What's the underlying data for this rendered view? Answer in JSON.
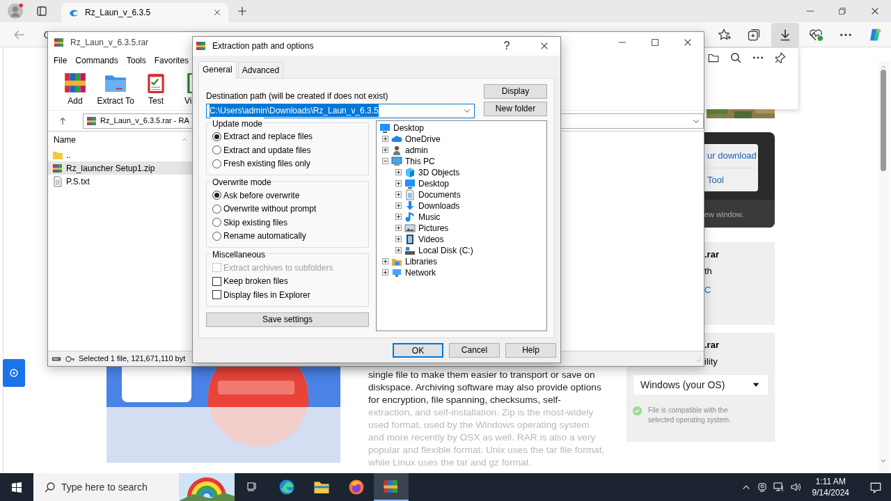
{
  "browser": {
    "tabs": [
      {
        "label": "Rz_Laun_v_6.3.5",
        "selected": true
      }
    ]
  },
  "page": {
    "cards": [
      {
        "kind": "dark",
        "links": [
          "ur download",
          "Tool"
        ],
        "note": "ew window."
      },
      {
        "kind": "light",
        "title": ".rar",
        "text": "th",
        "link": "C"
      },
      {
        "kind": "os",
        "title": ".rar",
        "text": "ility",
        "select": "Windows (your OS)",
        "note": "File is compatible with the selected operating system."
      }
    ],
    "paragraphs": [
      {
        "text": "single file to make them easier to transport or save on diskspace. Archiving software may also provide options for encryption, file spanning, checksums, self-",
        "faded": false
      },
      {
        "text": "extraction, and self-installation. Zip is the most-widely used format, used by the Windows operating system and more recently by OSX as well. RAR is also a very popular and flexible format. Unix uses the tar file format, while Linux uses the tar and gz format.",
        "faded": true
      }
    ]
  },
  "winrar": {
    "title": "Rz_Laun_v_6.3.5.rar",
    "menu": [
      "File",
      "Commands",
      "Tools",
      "Favorites"
    ],
    "toolbar": [
      {
        "label": "Add",
        "kind": "add"
      },
      {
        "label": "Extract To",
        "kind": "extract"
      },
      {
        "label": "Test",
        "kind": "test"
      },
      {
        "label": "Vi",
        "kind": "view"
      }
    ],
    "address": "Rz_Laun_v_6.3.5.rar - RA",
    "columns": [
      "Name"
    ],
    "files": [
      {
        "name": "..",
        "kind": "folder",
        "selected": false
      },
      {
        "name": "Rz_launcher Setup1.zip",
        "kind": "archive",
        "selected": true
      },
      {
        "name": "P.S.txt",
        "kind": "text",
        "selected": false
      }
    ],
    "status": "Selected 1 file, 121,671,110 byt"
  },
  "dialog": {
    "title": "Extraction path and options",
    "help": "?",
    "tabs": [
      {
        "label": "General",
        "selected": true
      },
      {
        "label": "Advanced",
        "selected": false
      }
    ],
    "path_label": "Destination path (will be created if does not exist)",
    "path": {
      "value": "C:\\Users\\admin\\Downloads\\Rz_Laun_v_6.3.5",
      "text_selected": true
    },
    "side_buttons": [
      "Display",
      "New folder"
    ],
    "groups": [
      {
        "title": "Update mode",
        "kind": "radio",
        "options": [
          {
            "label": "Extract and replace files",
            "selected": true
          },
          {
            "label": "Extract and update files",
            "selected": false
          },
          {
            "label": "Fresh existing files only",
            "selected": false
          }
        ]
      },
      {
        "title": "Overwrite mode",
        "kind": "radio",
        "options": [
          {
            "label": "Ask before overwrite",
            "selected": true
          },
          {
            "label": "Overwrite without prompt",
            "selected": false
          },
          {
            "label": "Skip existing files",
            "selected": false
          },
          {
            "label": "Rename automatically",
            "selected": false
          }
        ]
      },
      {
        "title": "Miscellaneous",
        "kind": "checkbox",
        "options": [
          {
            "label": "Extract archives to subfolders",
            "checked": false,
            "disabled": true
          },
          {
            "label": "Keep broken files",
            "checked": false,
            "disabled": false
          },
          {
            "label": "Display files in Explorer",
            "checked": false,
            "disabled": false
          }
        ]
      }
    ],
    "save_button": "Save settings",
    "tree": [
      {
        "label": "Desktop",
        "kind": "desktop",
        "children": [
          {
            "label": "OneDrive",
            "kind": "cloud",
            "expanded": false
          },
          {
            "label": "admin",
            "kind": "user",
            "expanded": false
          },
          {
            "label": "This PC",
            "kind": "pc",
            "expanded": true,
            "children": [
              {
                "label": "3D Objects",
                "kind": "cube",
                "expanded": false
              },
              {
                "label": "Desktop",
                "kind": "desktop",
                "expanded": false
              },
              {
                "label": "Documents",
                "kind": "documents",
                "expanded": false
              },
              {
                "label": "Downloads",
                "kind": "downloads",
                "expanded": false
              },
              {
                "label": "Music",
                "kind": "music",
                "expanded": false
              },
              {
                "label": "Pictures",
                "kind": "pictures",
                "expanded": false
              },
              {
                "label": "Videos",
                "kind": "videos",
                "expanded": false
              },
              {
                "label": "Local Disk (C:)",
                "kind": "disk",
                "expanded": false
              }
            ]
          },
          {
            "label": "Libraries",
            "kind": "libraries",
            "expanded": false
          },
          {
            "label": "Network",
            "kind": "network",
            "expanded": false
          }
        ]
      }
    ],
    "footer_buttons": [
      {
        "label": "OK",
        "default": true
      },
      {
        "label": "Cancel",
        "default": false
      },
      {
        "label": "Help",
        "default": false
      }
    ]
  },
  "taskbar": {
    "search": {
      "placeholder": "Type here to search"
    },
    "apps": [
      {
        "kind": "taskview",
        "selected": false
      },
      {
        "kind": "edge",
        "selected": false
      },
      {
        "kind": "explorer",
        "selected": false
      },
      {
        "kind": "firefox",
        "selected": false
      },
      {
        "kind": "winrar",
        "selected": true
      }
    ],
    "time": "1:11 AM",
    "date": "9/14/2024"
  }
}
